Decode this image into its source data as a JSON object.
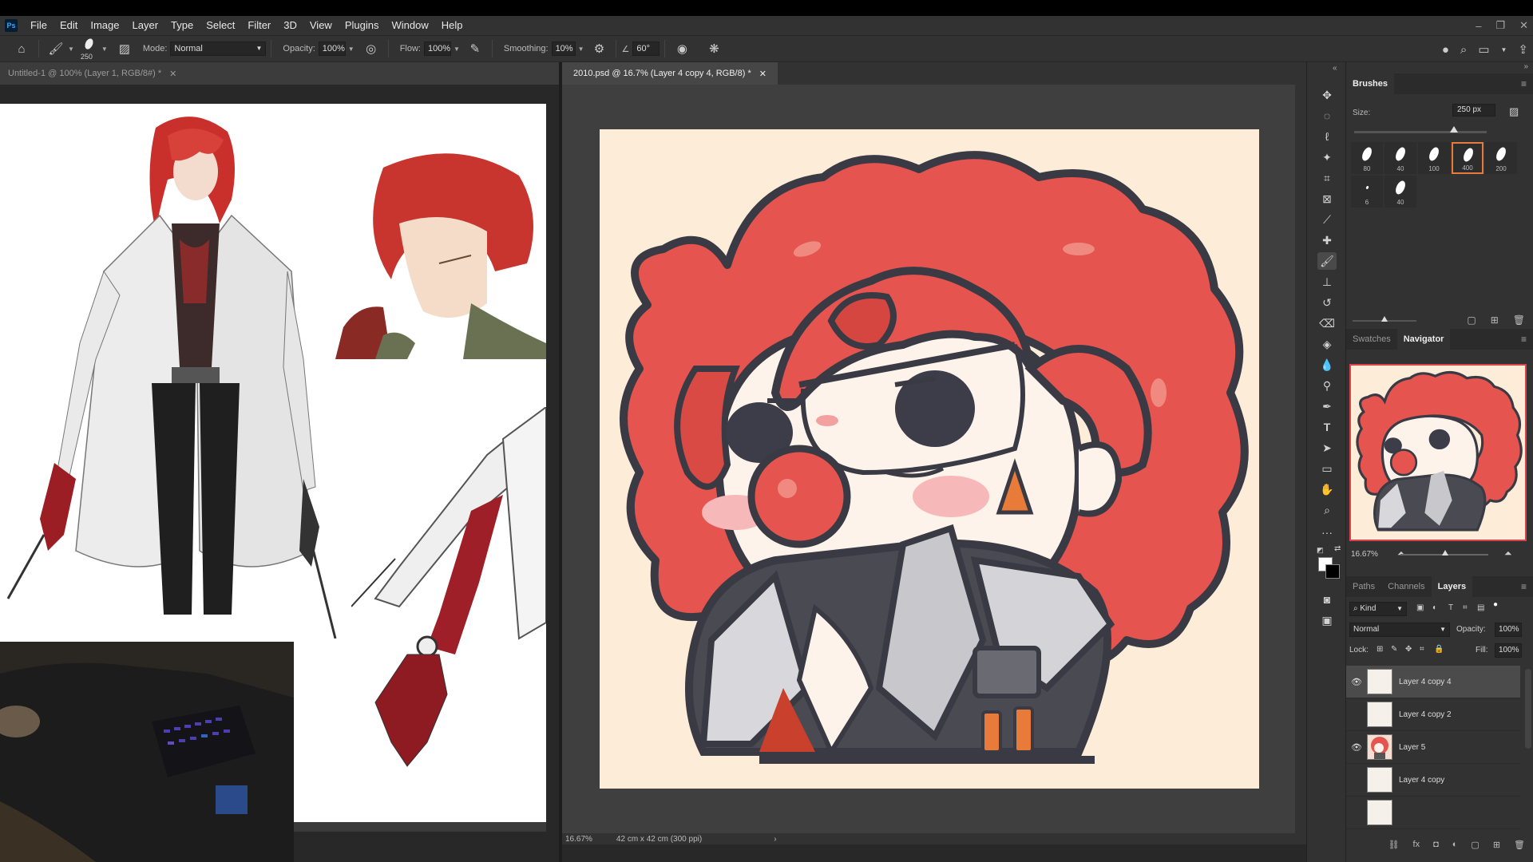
{
  "app": {
    "logo": "Ps"
  },
  "menu": [
    "File",
    "Edit",
    "Image",
    "Layer",
    "Type",
    "Select",
    "Filter",
    "3D",
    "View",
    "Plugins",
    "Window",
    "Help"
  ],
  "window_controls": [
    "minimize-icon",
    "restore-icon",
    "close-icon"
  ],
  "options": {
    "brush_size": "250",
    "mode_label": "Mode:",
    "mode_value": "Normal",
    "opacity_label": "Opacity:",
    "opacity_value": "100%",
    "flow_label": "Flow:",
    "flow_value": "100%",
    "smoothing_label": "Smoothing:",
    "smoothing_value": "10%",
    "angle_value": "60°"
  },
  "documents": {
    "doc1_tab": "Untitled-1 @ 100% (Layer 1, RGB/8#) *",
    "doc2_tab": "2010.psd @ 16.7% (Layer 4 copy 4, RGB/8) *"
  },
  "status": {
    "zoom": "16.67%",
    "doc_size": "42 cm x 42 cm (300 ppi)"
  },
  "brushes": {
    "title": "Brushes",
    "size_label": "Size:",
    "size_value": "250 px",
    "presets": [
      "80",
      "40",
      "100",
      "400",
      "200",
      "6",
      "40"
    ],
    "selected_index": 3
  },
  "navigator": {
    "tabs": [
      "Swatches",
      "Navigator"
    ],
    "active": "Navigator",
    "zoom": "16.67%"
  },
  "layers_panel": {
    "tabs": [
      "Paths",
      "Channels",
      "Layers"
    ],
    "active": "Layers",
    "filter": "Kind",
    "blend_mode": "Normal",
    "opacity_label": "Opacity:",
    "opacity_value": "100%",
    "lock_label": "Lock:",
    "fill_label": "Fill:",
    "fill_value": "100%",
    "layers": [
      {
        "name": "Layer 4 copy 4",
        "visible": true,
        "selected": true
      },
      {
        "name": "Layer 4 copy 2",
        "visible": false,
        "selected": false
      },
      {
        "name": "Layer 5",
        "visible": true,
        "selected": false
      },
      {
        "name": "Layer 4 copy",
        "visible": false,
        "selected": false
      }
    ]
  },
  "colors": {
    "canvas_bg": "#fcecd8",
    "hair_red": "#e5544f",
    "accent_orange": "#e87b3a",
    "ui_dark": "#323232"
  }
}
